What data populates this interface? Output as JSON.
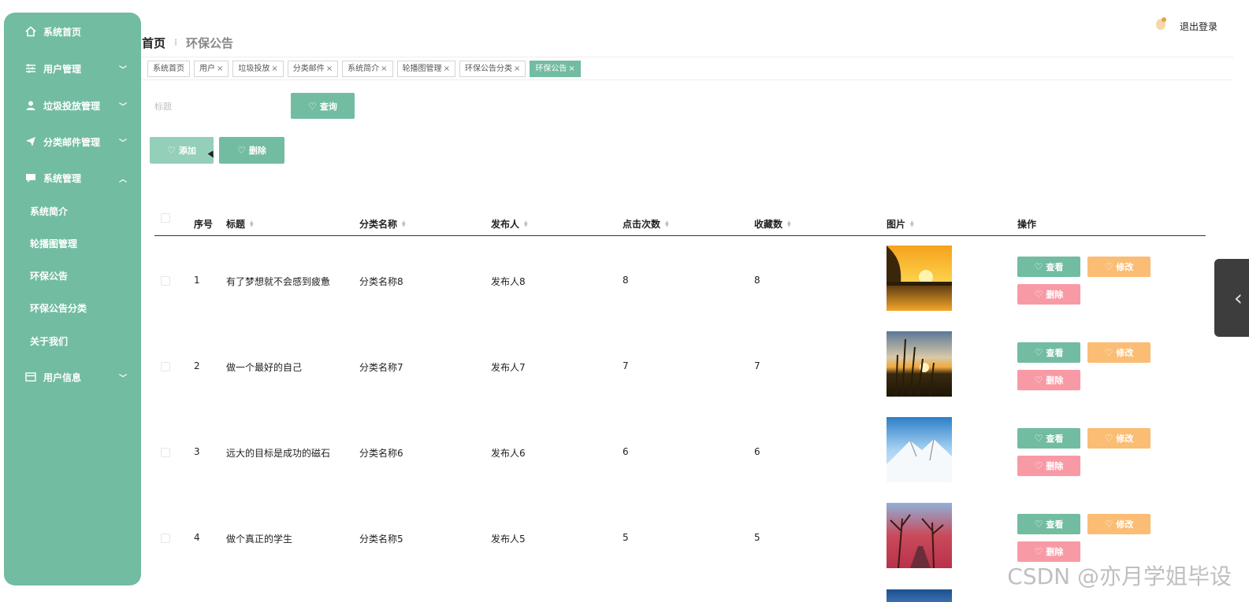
{
  "sidebar": {
    "items": [
      {
        "label": "系统首页",
        "icon": "home-icon"
      },
      {
        "label": "用户管理",
        "icon": "sliders-icon"
      },
      {
        "label": "垃圾投放管理",
        "icon": "user-icon"
      },
      {
        "label": "分类邮件管理",
        "icon": "send-icon"
      },
      {
        "label": "系统管理",
        "icon": "chat-icon"
      },
      {
        "label": "用户信息",
        "icon": "card-icon"
      }
    ],
    "submenu": [
      "系统简介",
      "轮播图管理",
      "环保公告",
      "环保公告分类",
      "关于我们"
    ]
  },
  "header": {
    "breadcrumb_home": "首页",
    "breadcrumb_current": "环保公告",
    "logout_label": "退出登录"
  },
  "tabs": [
    {
      "label": "系统首页",
      "closable": false
    },
    {
      "label": "用户",
      "closable": true
    },
    {
      "label": "垃圾投放",
      "closable": true
    },
    {
      "label": "分类邮件",
      "closable": true
    },
    {
      "label": "系统简介",
      "closable": true
    },
    {
      "label": "轮播图管理",
      "closable": true
    },
    {
      "label": "环保公告分类",
      "closable": true
    },
    {
      "label": "环保公告",
      "closable": true,
      "active": true
    }
  ],
  "tab_close": "×",
  "search": {
    "placeholder": "标题",
    "query_label": "查询"
  },
  "actions": {
    "add_label": "添加",
    "delete_label": "删除"
  },
  "table": {
    "columns": [
      "序号",
      "标题",
      "分类名称",
      "发布人",
      "点击次数",
      "收藏数",
      "图片",
      "操作"
    ],
    "row_actions": {
      "view": "查看",
      "edit": "修改",
      "delete": "删除"
    },
    "rows": [
      {
        "index": "1",
        "title": "有了梦想就不会感到疲惫",
        "category": "分类名称8",
        "publisher": "发布人8",
        "clicks": "8",
        "favorites": "8"
      },
      {
        "index": "2",
        "title": "做一个最好的自己",
        "category": "分类名称7",
        "publisher": "发布人7",
        "clicks": "7",
        "favorites": "7"
      },
      {
        "index": "3",
        "title": "远大的目标是成功的磁石",
        "category": "分类名称6",
        "publisher": "发布人6",
        "clicks": "6",
        "favorites": "6"
      },
      {
        "index": "4",
        "title": "做个真正的学生",
        "category": "分类名称5",
        "publisher": "发布人5",
        "clicks": "5",
        "favorites": "5"
      }
    ]
  },
  "watermark": "CSDN @亦月学姐毕设",
  "colors": {
    "primary": "#72bca2",
    "warning": "#fbbd74",
    "danger": "#f89aa5"
  }
}
